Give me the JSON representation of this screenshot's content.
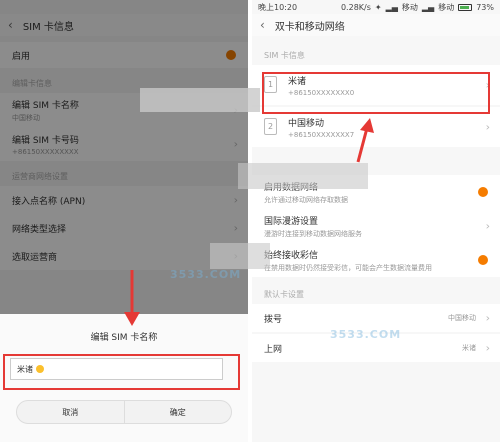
{
  "left": {
    "title": "SIM 卡信息",
    "enable_label": "启用",
    "section_edit": "编辑卡信息",
    "edit_name_title": "编辑 SIM 卡名称",
    "edit_name_sub": "中国移动",
    "edit_number_title": "编辑 SIM 卡号码",
    "edit_number_sub": "+86150XXXXXXXX",
    "section_net": "运营商网络设置",
    "apn_label": "接入点名称 (APN)",
    "net_type_label": "网络类型选择",
    "operator_label": "选取运营商",
    "dialog": {
      "title": "编辑 SIM 卡名称",
      "input_value": "米诸",
      "cancel": "取消",
      "ok": "确定"
    }
  },
  "right": {
    "status_time": "晚上10:20",
    "status_speed": "0.28K/s",
    "status_carrier": "移动",
    "status_battery": "73%",
    "title": "双卡和移动网络",
    "section_sim": "SIM 卡信息",
    "sim1_name": "米诸",
    "sim1_number": "+86150XXXXXXX0",
    "sim1_index": "1",
    "sim2_name": "中国移动",
    "sim2_number": "+86150XXXXXXX7",
    "sim2_index": "2",
    "data_label": "启用数据网络",
    "data_sub": "允许通过移动网络存取数据",
    "roam_label": "国际漫游设置",
    "roam_sub": "漫游时连接到移动数据网络服务",
    "mms_label": "始终接收彩信",
    "mms_sub": "在禁用数据时仍然接受彩信，可能会产生数据流量费用",
    "section_default": "默认卡设置",
    "dial_label": "拨号",
    "dial_value": "中国移动",
    "net_label": "上网",
    "net_value": "米诸"
  },
  "watermark": "3533.COM",
  "colors": {
    "accent": "#f57c00",
    "highlight": "#e53935"
  }
}
